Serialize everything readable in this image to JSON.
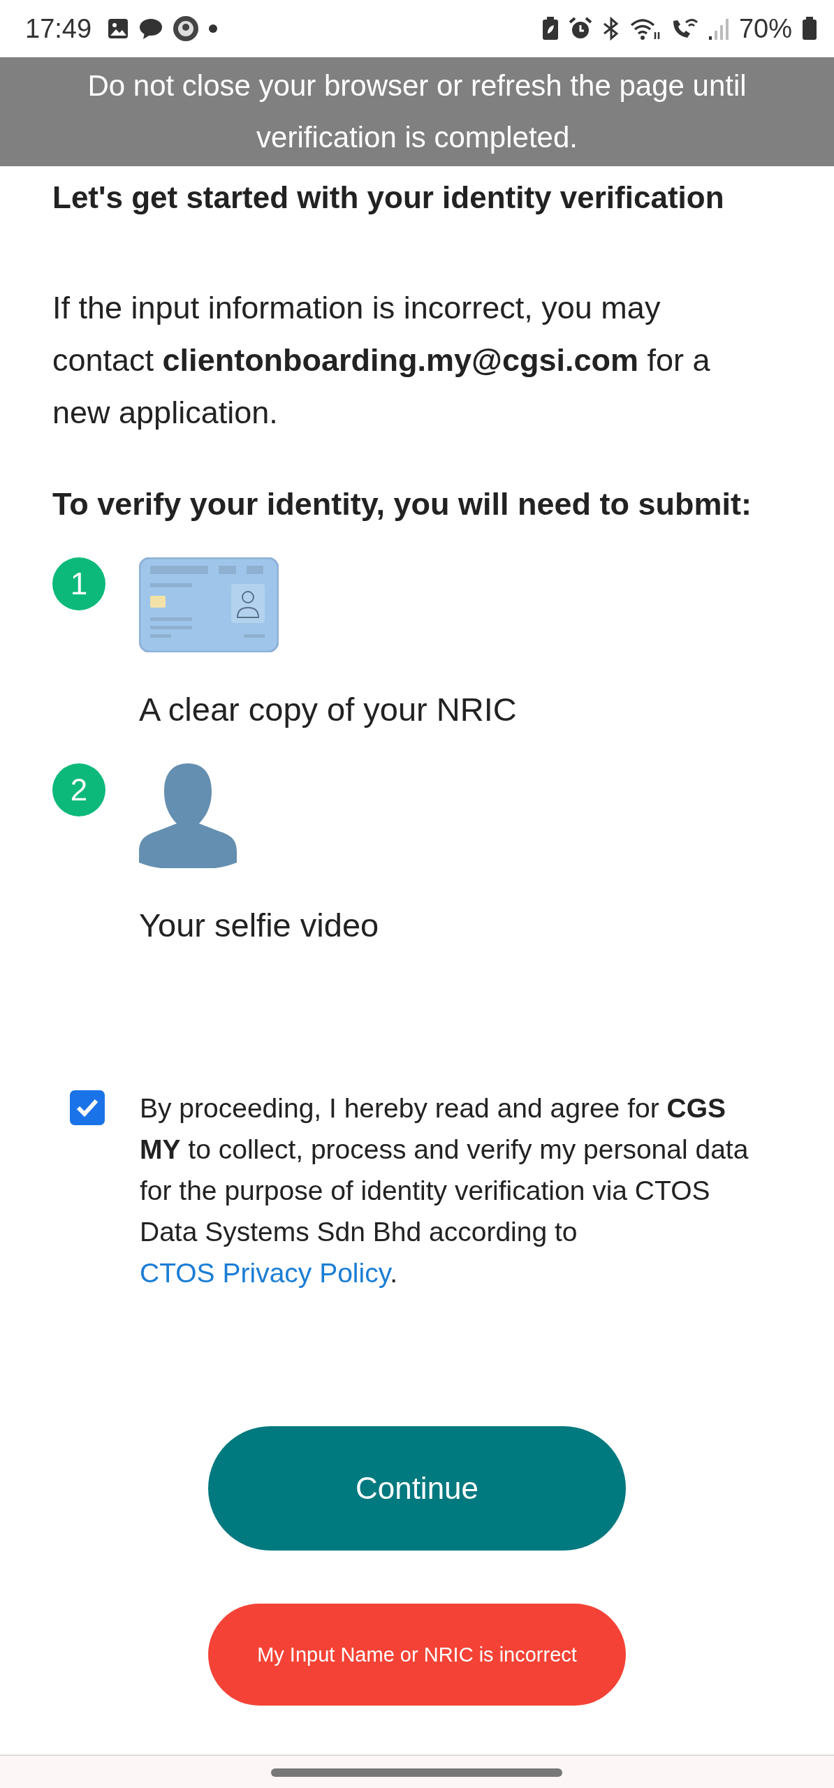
{
  "status_bar": {
    "time": "17:49",
    "battery": "70%"
  },
  "banner": {
    "text": "Do not close your browser or refresh the page until verification is completed."
  },
  "heading": "Let's get started with your identity verification",
  "notice": "If the input information is incorrect, you may contact **clientonboarding.my@cgsi.com** for a new application.",
  "requirements_title": "To verify your identity, you will need to submit:",
  "steps": [
    {
      "number": "1",
      "kind": "id_card",
      "label": "A clear copy of your NRIC"
    },
    {
      "number": "2",
      "kind": "person",
      "label": "Your selfie video"
    }
  ],
  "consent": {
    "checked": true,
    "text": "By proceeding, I hereby read and agree for **CGS MY** to collect, process and verify my personal data for the purpose of identity verification via CTOS Data Systems Sdn Bhd according to",
    "link": "CTOS Privacy Policy",
    "end": "."
  },
  "buttons": [
    {
      "kind": "primary",
      "label": "Continue"
    },
    {
      "kind": "danger",
      "label": "My Input Name or NRIC is incorrect"
    }
  ]
}
